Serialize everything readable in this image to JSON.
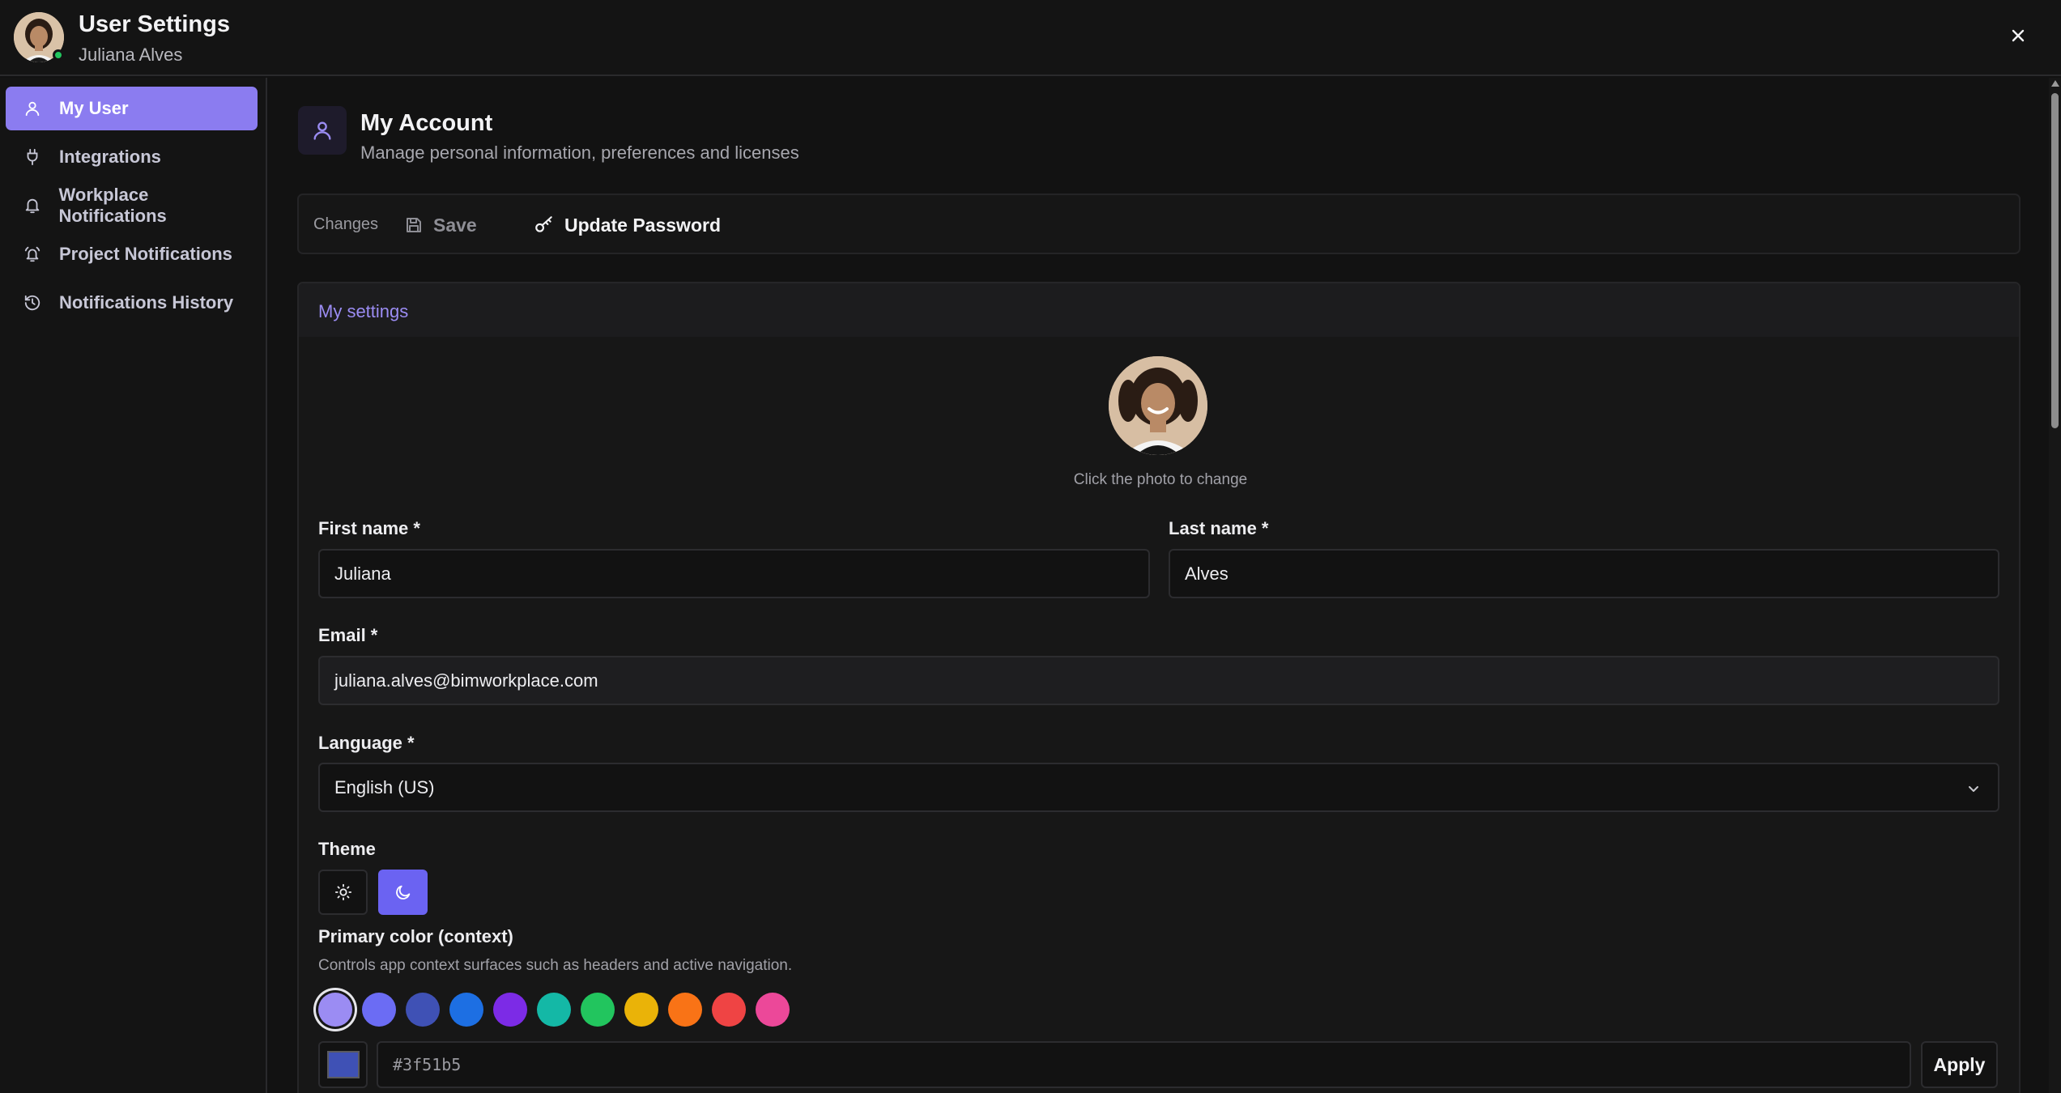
{
  "header": {
    "title": "User Settings",
    "user_name": "Juliana Alves",
    "online_color": "#22c55e"
  },
  "sidebar": {
    "items": [
      {
        "label": "My User",
        "icon": "user-icon",
        "active": true
      },
      {
        "label": "Integrations",
        "icon": "plug-icon",
        "active": false
      },
      {
        "label": "Workplace Notifications",
        "icon": "bell-icon",
        "active": false
      },
      {
        "label": "Project Notifications",
        "icon": "bell-ring-icon",
        "active": false
      },
      {
        "label": "Notifications History",
        "icon": "history-icon",
        "active": false
      }
    ]
  },
  "account": {
    "title": "My Account",
    "subtitle": "Manage personal information, preferences and licenses"
  },
  "toolbar": {
    "changes_label": "Changes",
    "save_label": "Save",
    "update_password_label": "Update Password"
  },
  "settings": {
    "section_title": "My settings",
    "photo_hint": "Click the photo to change",
    "first_name": {
      "label": "First name *",
      "value": "Juliana"
    },
    "last_name": {
      "label": "Last name *",
      "value": "Alves"
    },
    "email": {
      "label": "Email *",
      "value": "juliana.alves@bimworkplace.com"
    },
    "language": {
      "label": "Language *",
      "value": "English (US)"
    },
    "theme": {
      "label": "Theme",
      "selected": "dark"
    },
    "primary_color": {
      "label": "Primary color (context)",
      "hint": "Controls app context surfaces such as headers and active navigation.",
      "swatches": [
        "#9b8cf3",
        "#6b6cf4",
        "#3f51b5",
        "#1d6fe3",
        "#7c2be6",
        "#14b8a6",
        "#22c55e",
        "#eab308",
        "#f97316",
        "#ef4444",
        "#ec4899"
      ],
      "selected_index": 0,
      "hex_value": "#3f51b5",
      "apply_label": "Apply"
    }
  },
  "colors": {
    "accent": "#8b7cf0",
    "accent_text": "#9b8cf3",
    "dark_theme_button": "#6b63f2"
  }
}
